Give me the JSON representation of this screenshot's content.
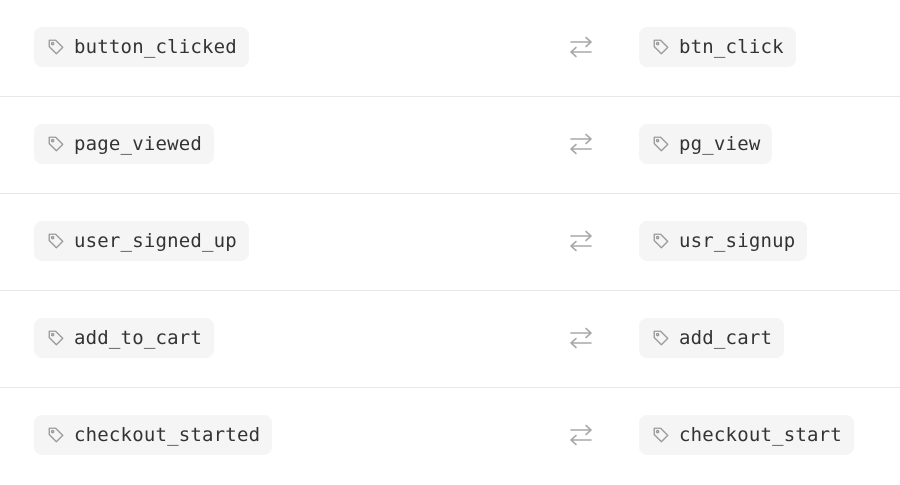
{
  "icons": {
    "tag": "tag-icon",
    "swap": "arrows-swap-icon"
  },
  "colors": {
    "tag_background": "#f5f5f5",
    "text": "#333333",
    "icon": "#9a9a9a",
    "divider": "#e8e8e8"
  },
  "mappings": [
    {
      "source": "button_clicked",
      "target": "btn_click"
    },
    {
      "source": "page_viewed",
      "target": "pg_view"
    },
    {
      "source": "user_signed_up",
      "target": "usr_signup"
    },
    {
      "source": "add_to_cart",
      "target": "add_cart"
    },
    {
      "source": "checkout_started",
      "target": "checkout_start"
    }
  ]
}
